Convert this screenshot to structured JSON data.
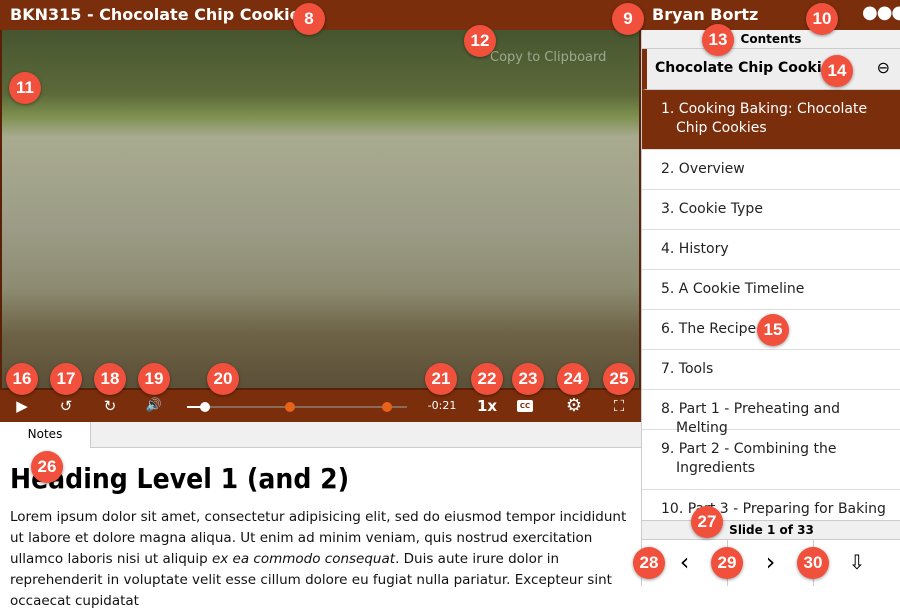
{
  "header": {
    "title": "BKN315 - Chocolate Chip Cookies",
    "user": "Bryan Bortz",
    "menu_icon": "more-dots-icon"
  },
  "video": {
    "copy_label": "Copy to Clipboard"
  },
  "controls": {
    "play": "▶",
    "rewind": "↺",
    "forward": "↻",
    "volume": "🔊",
    "time": "-0:21",
    "speed": "1x",
    "cc": "CC",
    "settings": "⚙",
    "fullscreen": "⛶",
    "progress_percent": 8,
    "markers_percent": [
      47,
      91
    ],
    "accent": "#e8621a"
  },
  "notes": {
    "tab": "Notes",
    "heading": "Heading Level 1 (and 2)",
    "p1": "Lorem ipsum dolor sit amet, consectetur adipisicing elit, sed do eiusmod tempor incididunt ut labore et dolore magna aliqua. Ut enim ad minim veniam, quis nostrud exercitation ullamco laboris nisi ut aliquip ",
    "p_italic": "ex ea commodo consequat",
    "p2": ". Duis aute irure dolor in reprehenderit in voluptate velit esse cillum dolore eu fugiat nulla pariatur. Excepteur sint occaecat cupidatat"
  },
  "sidebar": {
    "contents": "Contents",
    "section": "Chocolate Chip Cookies",
    "collapse": "⊖",
    "items": [
      "1. Cooking Baking: Chocolate Chip Cookies",
      "2. Overview",
      "3. Cookie Type",
      "4. History",
      "5. A Cookie Timeline",
      "6. The Recipe",
      "7. Tools",
      "8. Part 1 - Preheating and Melting",
      "9. Part 2 - Combining the Ingredients",
      "10. Part 3 - Preparing for Baking"
    ],
    "slide": "Slide 1 of 33",
    "prev": "‹",
    "next": "›",
    "download": "⇩"
  },
  "markers": [
    "8",
    "9",
    "10",
    "11",
    "12",
    "13",
    "14",
    "15",
    "16",
    "17",
    "18",
    "19",
    "20",
    "21",
    "22",
    "23",
    "24",
    "25",
    "26",
    "27",
    "28",
    "29",
    "30"
  ],
  "colors": {
    "brand": "#7a2e0c",
    "marker": "#f0503c"
  }
}
